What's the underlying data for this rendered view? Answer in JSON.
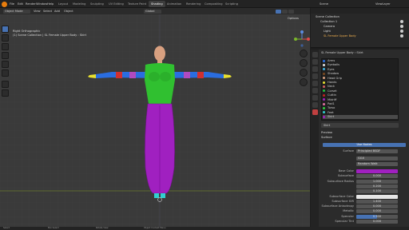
{
  "menus": [
    "File",
    "Edit",
    "Render",
    "Window",
    "Help"
  ],
  "workspaces": [
    "Layout",
    "Modeling",
    "Sculpting",
    "UV Editing",
    "Texture Paint",
    "Shading",
    "Animation",
    "Rendering",
    "Compositing",
    "Scripting"
  ],
  "active_workspace": "Shading",
  "scene": "Scene",
  "view_layer": "ViewLayer",
  "viewport": {
    "mode": "Object Mode",
    "view_menus": [
      "View",
      "Select",
      "Add",
      "Object"
    ],
    "transform": "Global",
    "overlay_title": "Right Orthographic",
    "overlay_sub": "(1) Scene Collection | SL Female Upper Body : Skirt",
    "options_label": "Options"
  },
  "outliner": {
    "title": "Scene Collection",
    "items": [
      "Collection 1",
      "Camera",
      "Light",
      "SL Female Upper Body"
    ]
  },
  "properties": {
    "object_name": "SL Female Upper Body",
    "object_data": "Skirt",
    "materials": [
      {
        "name": "Arms",
        "color": "#2a6de0"
      },
      {
        "name": "Eyeballs",
        "color": "#e0e0e0"
      },
      {
        "name": "Eyes",
        "color": "#3ab0e0"
      },
      {
        "name": "Shadow",
        "color": "#7a4a20"
      },
      {
        "name": "Head Grip",
        "color": "#d8a080"
      },
      {
        "name": "Hands",
        "color": "#e8e030"
      },
      {
        "name": "Neck",
        "color": "#d06060"
      },
      {
        "name": "Corset",
        "color": "#20c040"
      },
      {
        "name": "Cuttin",
        "color": "#c02020"
      },
      {
        "name": "Midriff",
        "color": "#a020c0"
      },
      {
        "name": "Pad1",
        "color": "#e070a0"
      },
      {
        "name": "Torso",
        "color": "#30d040"
      },
      {
        "name": "Feet",
        "color": "#30d0d0"
      },
      {
        "name": "Skirt",
        "color": "#a020c0"
      }
    ],
    "selected_material": "Skirt",
    "slot_name": "Skirt",
    "sections": {
      "preview": "Preview",
      "surface": "Surface"
    },
    "use_nodes_label": "Use Nodes",
    "surface_label": "Surface",
    "surface_shader": "Principled BSDF",
    "distribution": "GGX",
    "subsurface_method": "Random Walk",
    "params": [
      {
        "label": "Base Color",
        "value": "",
        "type": "color",
        "color": "#a020c0"
      },
      {
        "label": "Subsurface",
        "value": "0.000",
        "type": "num"
      },
      {
        "label": "Subsurface Radius",
        "value": "1.000",
        "type": "num"
      },
      {
        "label": "",
        "value": "0.200",
        "type": "num"
      },
      {
        "label": "",
        "value": "0.100",
        "type": "num"
      },
      {
        "label": "Subsurface Color",
        "value": "",
        "type": "color",
        "color": "#e6e6e6"
      },
      {
        "label": "Subsurface IOR",
        "value": "1.400",
        "type": "num"
      },
      {
        "label": "Subsurface Anisotropy",
        "value": "0.000",
        "type": "num"
      },
      {
        "label": "Metallic",
        "value": "0.000",
        "type": "num"
      },
      {
        "label": "Specular",
        "value": "0.500",
        "type": "slider",
        "fill": 0.5
      },
      {
        "label": "Specular Tint",
        "value": "0.000",
        "type": "num"
      }
    ]
  },
  "statusbar": {
    "left": "Select",
    "middle": "Box Select",
    "right": "Rotate View",
    "far_right": "Object Context Menu"
  },
  "colors": {
    "accent": "#4772b3",
    "skirt": "#a020c0",
    "torso": "#30c030",
    "arm_blue": "#2a6de0",
    "arm_red": "#d03030",
    "hands": "#e8e030",
    "skin": "#d8a080",
    "feet": "#30d0d0"
  }
}
